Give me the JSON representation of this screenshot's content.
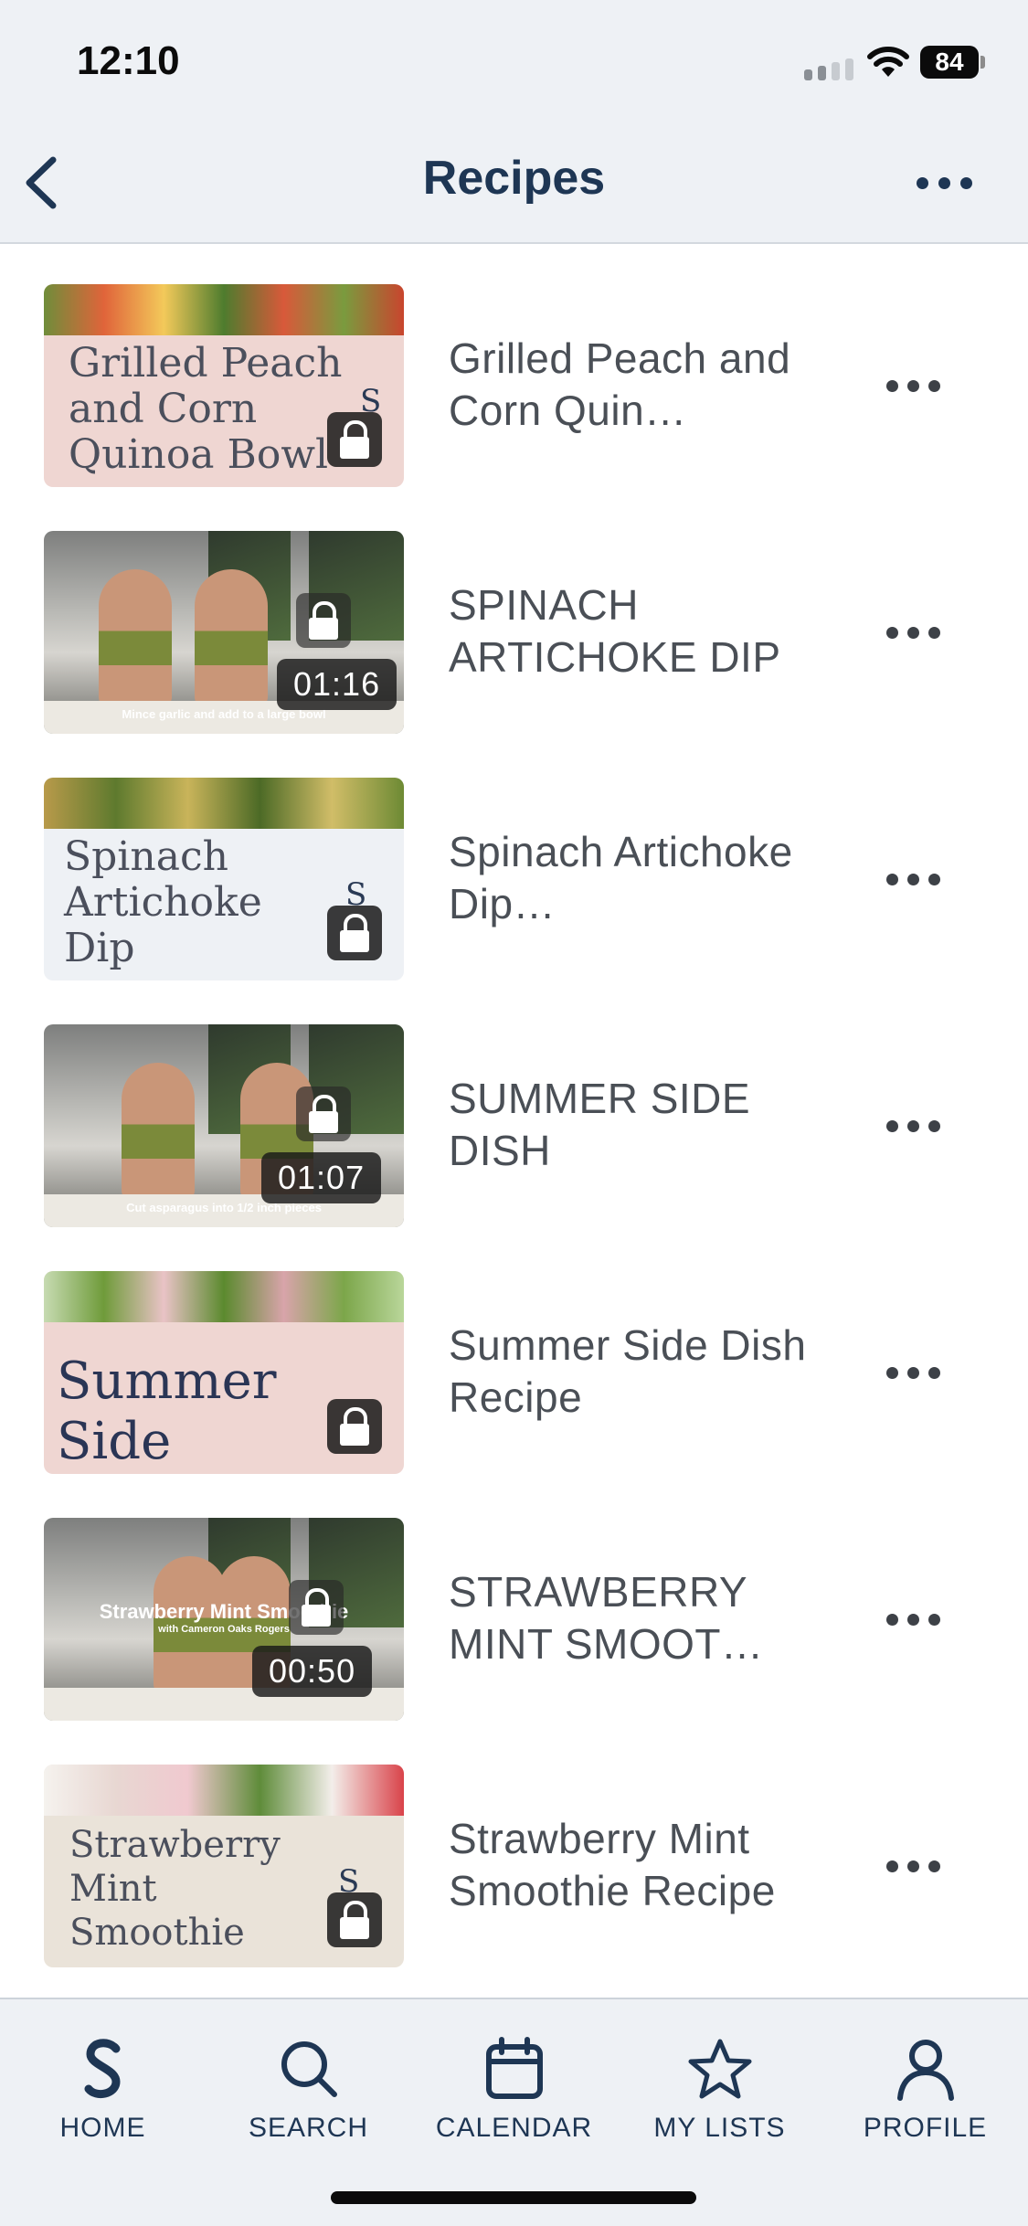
{
  "status_bar": {
    "time": "12:10",
    "battery": "84"
  },
  "nav": {
    "title": "Recipes",
    "back_icon": "chevron-left-icon",
    "more_icon": "ellipsis-icon"
  },
  "recipes": [
    {
      "title": "Grilled Peach and Corn Quin…",
      "thumb_text": "Grilled Peach and Corn Quinoa Bowl",
      "kind": "card",
      "locked": true
    },
    {
      "title": "SPINACH ARTICHOKE DIP",
      "kind": "video",
      "duration": "01:16",
      "caption": "Mince garlic and add to a large bowl",
      "locked": true
    },
    {
      "title": "Spinach Artichoke Dip…",
      "thumb_text": "Spinach Artichoke Dip",
      "kind": "card",
      "locked": true
    },
    {
      "title": "SUMMER SIDE DISH",
      "kind": "video",
      "duration": "01:07",
      "caption": "Cut asparagus into 1/2 inch pieces",
      "locked": true
    },
    {
      "title": "Summer Side Dish Recipe",
      "thumb_text": "Summer Side Dish",
      "kind": "card",
      "locked": true
    },
    {
      "title": "STRAWBERRY MINT SMOOT…",
      "kind": "video",
      "duration": "00:50",
      "caption": "Strawberry Mint Smoothie",
      "caption_sub": "with Cameron Oaks Rogers",
      "locked": true
    },
    {
      "title": "Strawberry Mint Smoothie Recipe",
      "thumb_text": "Strawberry Mint Smoothie",
      "kind": "card",
      "locked": true
    }
  ],
  "tabs": [
    {
      "label": "HOME",
      "icon": "home-logo-icon"
    },
    {
      "label": "SEARCH",
      "icon": "search-icon"
    },
    {
      "label": "CALENDAR",
      "icon": "calendar-icon"
    },
    {
      "label": "MY LISTS",
      "icon": "star-icon"
    },
    {
      "label": "PROFILE",
      "icon": "profile-icon"
    }
  ],
  "colors": {
    "nav_bg": "#eef1f5",
    "accent": "#1e3654",
    "text": "#4a4f56"
  }
}
